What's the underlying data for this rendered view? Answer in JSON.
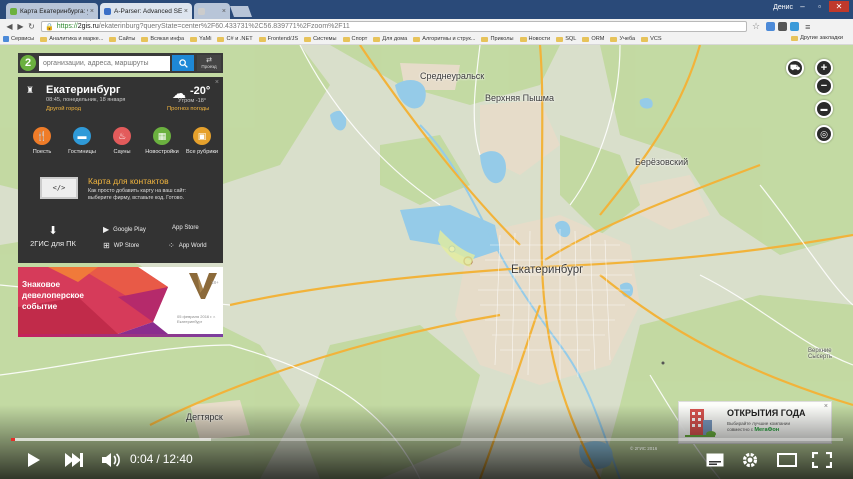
{
  "browser": {
    "tabs": [
      {
        "title": "Карта Екатеринбурга: ул...",
        "active": false,
        "favicon_color": "#6bb13f"
      },
      {
        "title": "A-Parser: Advanced SE Pa...",
        "active": true,
        "favicon_color": "#3b6fc7"
      },
      {
        "title": "",
        "active": false,
        "favicon_color": "#cccccc"
      }
    ],
    "user": "Денис",
    "url": {
      "scheme": "https://",
      "host": "2gis.ru",
      "path": "/ekaterinburg?queryState=center%2F60.433731%2C56.839771%2Fzoom%2F11"
    },
    "bookmarks": [
      {
        "label": "Сервисы",
        "type": "app"
      },
      {
        "label": "Аналитика и марке...",
        "type": "folder"
      },
      {
        "label": "Сайты",
        "type": "folder"
      },
      {
        "label": "Всякая инфа",
        "type": "folder"
      },
      {
        "label": "YaMi",
        "type": "folder"
      },
      {
        "label": "C# и .NET",
        "type": "folder"
      },
      {
        "label": "Frontend/JS",
        "type": "folder"
      },
      {
        "label": "Системы",
        "type": "folder"
      },
      {
        "label": "Спорт",
        "type": "folder"
      },
      {
        "label": "Для дома",
        "type": "folder"
      },
      {
        "label": "Алгоритмы и струк...",
        "type": "folder"
      },
      {
        "label": "Приколы",
        "type": "folder"
      },
      {
        "label": "Новости",
        "type": "folder"
      },
      {
        "label": "SQL",
        "type": "folder"
      },
      {
        "label": "ORM",
        "type": "folder"
      },
      {
        "label": "Учеба",
        "type": "folder"
      },
      {
        "label": "VCS",
        "type": "folder"
      }
    ],
    "other_bookmarks": "Другие закладки"
  },
  "search": {
    "placeholder": "организации, адреса, маршруты",
    "route_label": "Проезд"
  },
  "city_card": {
    "name": "Екатеринбург",
    "time": "08:45, понедельник, 18 января",
    "other_city": "Другой город",
    "temperature": "-20°",
    "morning": "Утром -18°",
    "forecast": "Прогноз погоды",
    "categories": [
      {
        "label": "Поесть",
        "color": "#f07c28",
        "icon": "fork-icon"
      },
      {
        "label": "Гостиницы",
        "color": "#2f9ad8",
        "icon": "bed-icon"
      },
      {
        "label": "Сауны",
        "color": "#e35b5b",
        "icon": "sauna-icon"
      },
      {
        "label": "Новостройки",
        "color": "#6bb13f",
        "icon": "building-icon"
      },
      {
        "label": "Все рубрики",
        "color": "#e6a12c",
        "icon": "briefcase-icon"
      }
    ],
    "contacts_title": "Карта для контактов",
    "contacts_text": "Как просто добавить карту на ваш сайт: выберите фирму, вставьте код. Готово.",
    "pc_label": "2ГИС для ПК",
    "stores": [
      {
        "label": "Google Play",
        "icon": "play-icon"
      },
      {
        "label": "App Store",
        "icon": "apple-icon"
      },
      {
        "label": "WP Store",
        "icon": "windows-icon"
      },
      {
        "label": "App World",
        "icon": "blackberry-icon"
      }
    ]
  },
  "ad_banner": {
    "line1": "Знаковое",
    "line2": "девелоперское",
    "line3": "событие",
    "badge": "V",
    "age": "18+",
    "subtext": "05 февраля 2016 г. г. Екатеринбург"
  },
  "map": {
    "cities": [
      {
        "name": "Среднеуральск",
        "size": "mid"
      },
      {
        "name": "Верхняя Пышма",
        "size": "mid"
      },
      {
        "name": "Берёзовский",
        "size": "mid"
      },
      {
        "name": "Екатеринбург",
        "size": "big"
      },
      {
        "name": "Дегтярск",
        "size": "mid"
      },
      {
        "name": "Верхние Сысерть",
        "size": "sm"
      }
    ],
    "attribution": "© 2ГИС 2016"
  },
  "promo": {
    "title": "ОТКРЫТИЯ ГОДА",
    "text1": "Выбирайте лучшие компании",
    "text2": "совместно с",
    "brand": "МегаФон"
  },
  "player": {
    "current_time": "0:04",
    "duration": "12:40",
    "progress_fraction": 0.0053,
    "loaded_fraction": 0.24
  },
  "colors": {
    "accent_green": "#6bb13f",
    "accent_blue": "#1e88d6",
    "accent_orange": "#f1b53f",
    "player_red": "#e52d27"
  }
}
